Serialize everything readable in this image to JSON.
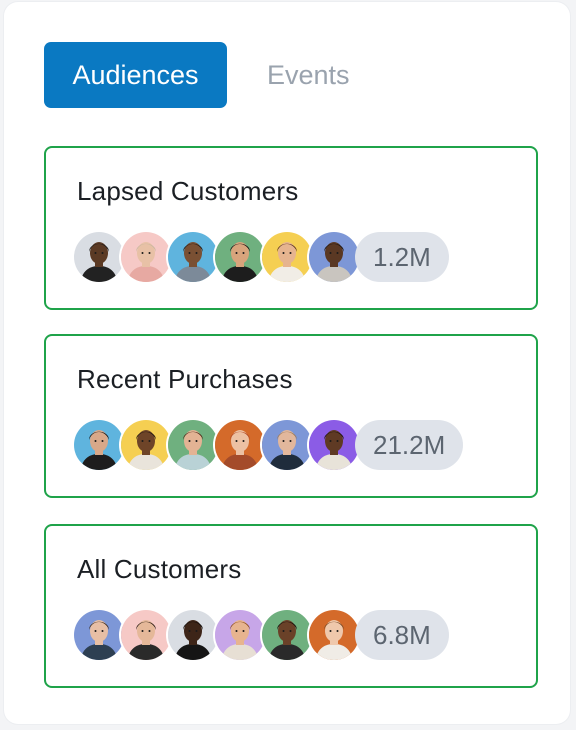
{
  "tabs": [
    {
      "label": "Audiences",
      "active": true
    },
    {
      "label": "Events",
      "active": false
    }
  ],
  "audiences": [
    {
      "name": "Lapsed Customers",
      "count": "1.2M",
      "avatars": [
        {
          "bg": "#d9dde3",
          "skin": "#5b3a24",
          "hair": "#1a1a1a",
          "shirt": "#222222"
        },
        {
          "bg": "#f6c9c6",
          "skin": "#e8c1a6",
          "hair": "#c9b8a0",
          "shirt": "#e7a9a2"
        },
        {
          "bg": "#5fb4de",
          "skin": "#7a5033",
          "hair": "#231a14",
          "shirt": "#7c8a99"
        },
        {
          "bg": "#6fb07f",
          "skin": "#d8a47c",
          "hair": "#111111",
          "shirt": "#1d1d1d"
        },
        {
          "bg": "#f5cf52",
          "skin": "#e6b48f",
          "hair": "#5a3420",
          "shirt": "#f1ede6"
        },
        {
          "bg": "#7d97d7",
          "skin": "#5a3823",
          "hair": "#1b1410",
          "shirt": "#c9c5bf"
        }
      ]
    },
    {
      "name": "Recent Purchases",
      "count": "21.2M",
      "avatars": [
        {
          "bg": "#5fb4de",
          "skin": "#d8a889",
          "hair": "#141414",
          "shirt": "#1d1d1d"
        },
        {
          "bg": "#f5cf52",
          "skin": "#6e4428",
          "hair": "#1f1510",
          "shirt": "#e9e4db"
        },
        {
          "bg": "#6fb07f",
          "skin": "#e3b394",
          "hair": "#4a2a18",
          "shirt": "#b9d2d6"
        },
        {
          "bg": "#d46a2a",
          "skin": "#ecc1a3",
          "hair": "#b44a25",
          "shirt": "#a44b2a"
        },
        {
          "bg": "#7d97d7",
          "skin": "#e2b79c",
          "hair": "#9b7a5a",
          "shirt": "#1f2c3c"
        },
        {
          "bg": "#8b5ce6",
          "skin": "#5f3a24",
          "hair": "#1b120d",
          "shirt": "#e8e3d9"
        }
      ]
    },
    {
      "name": "All Customers",
      "count": "6.8M",
      "avatars": [
        {
          "bg": "#7d97d7",
          "skin": "#e7bfa5",
          "hair": "#3a2a1f",
          "shirt": "#2d3f52"
        },
        {
          "bg": "#f6c9c6",
          "skin": "#e5b899",
          "hair": "#2a1b13",
          "shirt": "#2a2a2a"
        },
        {
          "bg": "#d9dde3",
          "skin": "#3d2518",
          "hair": "#0f0b09",
          "shirt": "#151515"
        },
        {
          "bg": "#c7a6e8",
          "skin": "#e7b48f",
          "hair": "#8a4a1f",
          "shirt": "#e7dfd4"
        },
        {
          "bg": "#6fb07f",
          "skin": "#6a4128",
          "hair": "#120d0a",
          "shirt": "#2a2a2a"
        },
        {
          "bg": "#d46a2a",
          "skin": "#efc8ac",
          "hair": "#7a4a27",
          "shirt": "#f0ece6"
        }
      ]
    }
  ]
}
